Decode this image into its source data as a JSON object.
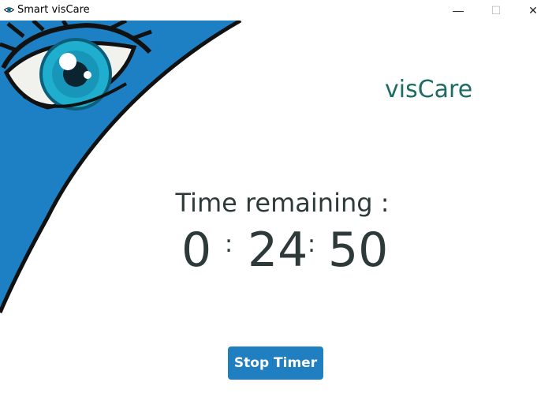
{
  "window": {
    "title": "Smart visCare",
    "controls": {
      "minimize": "—",
      "maximize": "☐",
      "close": "✕"
    }
  },
  "brand": {
    "name": "visCare"
  },
  "timer": {
    "label": "Time remaining :",
    "hours": "0",
    "minutes": "24",
    "seconds": "50",
    "separator": ":"
  },
  "actions": {
    "stop_label": "Stop Timer"
  },
  "colors": {
    "accent_blue": "#1f7fc0",
    "brand_teal": "#1e6b64",
    "text_dark": "#2e3a3a"
  }
}
